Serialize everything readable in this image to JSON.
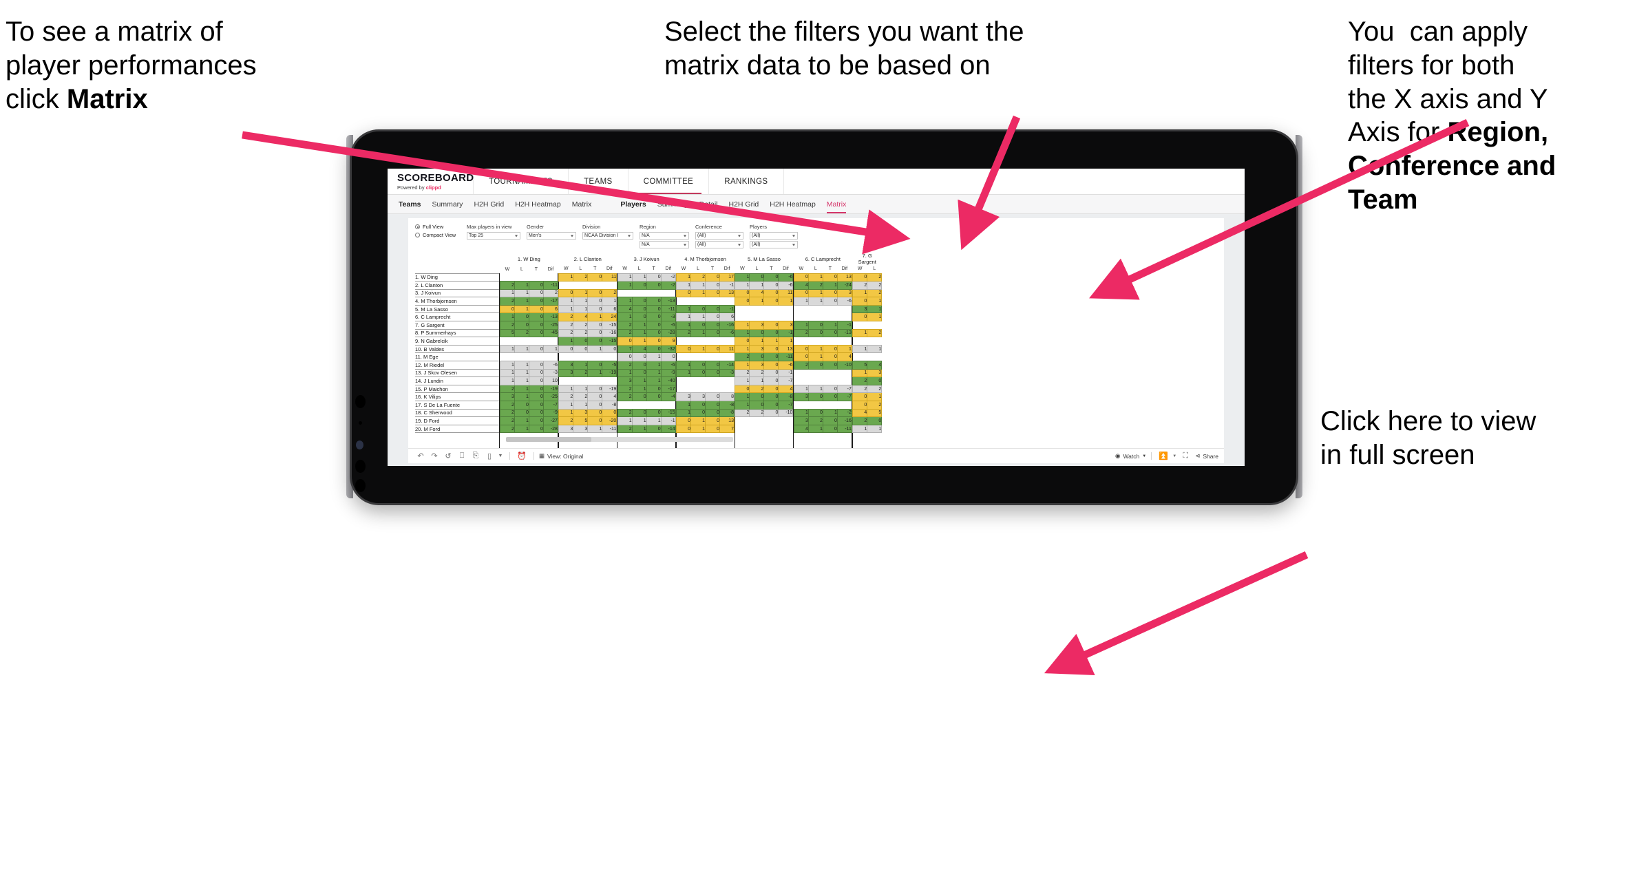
{
  "annotations": {
    "left": {
      "pre": "To see a matrix of\nplayer performances\nclick ",
      "bold": "Matrix"
    },
    "center": {
      "text": "Select the filters you want the\nmatrix data to be based on"
    },
    "right": {
      "pre": "You  can apply\nfilters for both\nthe X axis and Y\nAxis for ",
      "bold": "Region,\nConference and\nTeam"
    },
    "fullscreen": {
      "text": "Click here to view\nin full screen"
    }
  },
  "colors": {
    "accent_pink": "#ec2a64",
    "brand_pink": "#e8275e",
    "tab_active": "#d5366a",
    "cell_green": "#6aa84f",
    "cell_yellow": "#f2c744",
    "cell_grey": "#d9d9d9"
  },
  "app": {
    "brand": {
      "title": "SCOREBOARD",
      "powered_prefix": "Powered by ",
      "powered_name": "clippd"
    },
    "topnav": [
      {
        "label": "TOURNAMENTS",
        "active": false
      },
      {
        "label": "TEAMS",
        "active": false
      },
      {
        "label": "COMMITTEE",
        "active": true
      },
      {
        "label": "RANKINGS",
        "active": false
      }
    ],
    "subnav": [
      {
        "head": "Teams",
        "items": [
          {
            "label": "Summary",
            "active": false
          },
          {
            "label": "H2H Grid",
            "active": false
          },
          {
            "label": "H2H Heatmap",
            "active": false
          },
          {
            "label": "Matrix",
            "active": false
          }
        ]
      },
      {
        "head": "Players",
        "items": [
          {
            "label": "Summary",
            "active": false
          },
          {
            "label": "Detail",
            "active": false
          },
          {
            "label": "H2H Grid",
            "active": false
          },
          {
            "label": "H2H Heatmap",
            "active": false
          },
          {
            "label": "Matrix",
            "active": true
          }
        ]
      }
    ]
  },
  "filters": {
    "view_mode": {
      "full_label": "Full View",
      "compact_label": "Compact View",
      "selected": "Full View"
    },
    "fields": [
      {
        "label": "Max players in view",
        "values": [
          "Top 25"
        ]
      },
      {
        "label": "Gender",
        "values": [
          "Men's"
        ]
      },
      {
        "label": "Division",
        "values": [
          "NCAA Division I"
        ]
      },
      {
        "label": "Region",
        "values": [
          "N/A",
          "N/A"
        ]
      },
      {
        "label": "Conference",
        "values": [
          "(All)",
          "(All)"
        ]
      },
      {
        "label": "Players",
        "values": [
          "(All)",
          "(All)"
        ]
      }
    ]
  },
  "matrix": {
    "sub_headers": [
      "W",
      "L",
      "T",
      "Dif"
    ],
    "columns": [
      {
        "label": "1. W Ding",
        "fields": 4
      },
      {
        "label": "2. L Clanton",
        "fields": 4
      },
      {
        "label": "3. J Koivun",
        "fields": 4
      },
      {
        "label": "4. M Thorbjornsen",
        "fields": 4
      },
      {
        "label": "5. M La Sasso",
        "fields": 4
      },
      {
        "label": "6. C Lamprecht",
        "fields": 4
      },
      {
        "label": "7. G Sargent",
        "fields": 2
      }
    ],
    "rows": [
      {
        "name": "1. W Ding",
        "cells": [
          [
            null,
            null,
            null,
            null
          ],
          [
            "1",
            "2",
            "0",
            "11",
            "y"
          ],
          [
            "1",
            "1",
            "0",
            "-2",
            "n"
          ],
          [
            "1",
            "2",
            "0",
            "17",
            "y"
          ],
          [
            "1",
            "0",
            "0",
            "-6",
            "g"
          ],
          [
            "0",
            "1",
            "0",
            "13",
            "y"
          ],
          [
            "0",
            "2",
            "y"
          ]
        ]
      },
      {
        "name": "2. L Clanton",
        "cells": [
          [
            "2",
            "1",
            "0",
            "-11",
            "g"
          ],
          [
            null,
            null,
            null,
            null
          ],
          [
            "1",
            "0",
            "0",
            "-2",
            "g"
          ],
          [
            "1",
            "1",
            "0",
            "-1",
            "n"
          ],
          [
            "1",
            "1",
            "0",
            "-6",
            "n"
          ],
          [
            "4",
            "2",
            "1",
            "-24",
            "g"
          ],
          [
            "2",
            "2",
            "n"
          ]
        ]
      },
      {
        "name": "3. J Koivun",
        "cells": [
          [
            "1",
            "1",
            "0",
            "2",
            "n"
          ],
          [
            "0",
            "1",
            "0",
            "2",
            "y"
          ],
          [
            null,
            null,
            null,
            null
          ],
          [
            "0",
            "1",
            "0",
            "13",
            "y"
          ],
          [
            "0",
            "4",
            "0",
            "11",
            "y"
          ],
          [
            "0",
            "1",
            "0",
            "3",
            "y"
          ],
          [
            "1",
            "2",
            "y"
          ]
        ]
      },
      {
        "name": "4. M Thorbjornsen",
        "cells": [
          [
            "2",
            "1",
            "0",
            "-17",
            "g"
          ],
          [
            "1",
            "1",
            "0",
            "1",
            "n"
          ],
          [
            "1",
            "0",
            "0",
            "-13",
            "g"
          ],
          [
            null,
            null,
            null,
            null
          ],
          [
            "0",
            "1",
            "0",
            "1",
            "y"
          ],
          [
            "1",
            "1",
            "0",
            "-6",
            "n"
          ],
          [
            "0",
            "1",
            "y"
          ]
        ]
      },
      {
        "name": "5. M La Sasso",
        "cells": [
          [
            "0",
            "1",
            "0",
            "6",
            "y"
          ],
          [
            "1",
            "1",
            "0",
            "6",
            "n"
          ],
          [
            "4",
            "0",
            "0",
            "-11",
            "g"
          ],
          [
            "1",
            "0",
            "0",
            "-1",
            "g"
          ],
          [
            null,
            null,
            null,
            null
          ],
          [
            null,
            null,
            null,
            null
          ],
          [
            "3",
            "1",
            "g"
          ]
        ]
      },
      {
        "name": "6. C Lamprecht",
        "cells": [
          [
            "1",
            "0",
            "0",
            "-13",
            "g"
          ],
          [
            "2",
            "4",
            "1",
            "24",
            "y"
          ],
          [
            "1",
            "0",
            "0",
            "-3",
            "g"
          ],
          [
            "1",
            "1",
            "0",
            "6",
            "n"
          ],
          [
            null,
            null,
            null,
            null
          ],
          [
            null,
            null,
            null,
            null
          ],
          [
            "0",
            "1",
            "y"
          ]
        ]
      },
      {
        "name": "7. G Sargent",
        "cells": [
          [
            "2",
            "0",
            "0",
            "-25",
            "g"
          ],
          [
            "2",
            "2",
            "0",
            "-15",
            "n"
          ],
          [
            "2",
            "1",
            "0",
            "-6",
            "g"
          ],
          [
            "1",
            "0",
            "0",
            "-16",
            "g"
          ],
          [
            "1",
            "3",
            "0",
            "3",
            "y"
          ],
          [
            "1",
            "0",
            "1",
            "-1",
            "g"
          ],
          [
            null,
            null
          ]
        ]
      },
      {
        "name": "8. P Summerhays",
        "cells": [
          [
            "5",
            "2",
            "0",
            "-45",
            "g"
          ],
          [
            "2",
            "2",
            "0",
            "-16",
            "n"
          ],
          [
            "2",
            "1",
            "0",
            "-28",
            "g"
          ],
          [
            "2",
            "1",
            "0",
            "-6",
            "g"
          ],
          [
            "1",
            "0",
            "0",
            "-1",
            "g"
          ],
          [
            "2",
            "0",
            "0",
            "-13",
            "g"
          ],
          [
            "1",
            "2",
            "y"
          ]
        ]
      },
      {
        "name": "9. N Gabrelcik",
        "cells": [
          [
            null,
            null,
            null,
            null
          ],
          [
            "1",
            "0",
            "0",
            "-15",
            "g"
          ],
          [
            "0",
            "1",
            "0",
            "9",
            "y"
          ],
          [
            null,
            null,
            null,
            null
          ],
          [
            "0",
            "1",
            "1",
            "1",
            "y"
          ],
          [
            null,
            null,
            null,
            null
          ],
          [
            null,
            null
          ]
        ]
      },
      {
        "name": "10. B Valdes",
        "cells": [
          [
            "1",
            "1",
            "0",
            "1",
            "n"
          ],
          [
            "0",
            "0",
            "1",
            "0",
            "n"
          ],
          [
            "7",
            "4",
            "0",
            "-32",
            "g"
          ],
          [
            "0",
            "1",
            "0",
            "11",
            "y"
          ],
          [
            "1",
            "3",
            "0",
            "13",
            "y"
          ],
          [
            "0",
            "1",
            "0",
            "1",
            "y"
          ],
          [
            "1",
            "1",
            "n"
          ]
        ]
      },
      {
        "name": "11. M Ege",
        "cells": [
          [
            null,
            null,
            null,
            null
          ],
          [
            null,
            null,
            null,
            null
          ],
          [
            "0",
            "0",
            "1",
            "0",
            "n"
          ],
          [
            null,
            null,
            null,
            null
          ],
          [
            "2",
            "0",
            "0",
            "-11",
            "g"
          ],
          [
            "0",
            "1",
            "0",
            "4",
            "y"
          ],
          [
            null,
            null
          ]
        ]
      },
      {
        "name": "12. M Riedel",
        "cells": [
          [
            "1",
            "1",
            "0",
            "-6",
            "n"
          ],
          [
            "3",
            "1",
            "0",
            "-5",
            "g"
          ],
          [
            "2",
            "0",
            "1",
            "-6",
            "g"
          ],
          [
            "1",
            "0",
            "0",
            "-14",
            "g"
          ],
          [
            "1",
            "3",
            "0",
            "-6",
            "y"
          ],
          [
            "2",
            "0",
            "0",
            "-10",
            "g"
          ],
          [
            "5",
            "4",
            "g"
          ]
        ]
      },
      {
        "name": "13. J Skov Olesen",
        "cells": [
          [
            "1",
            "1",
            "0",
            "-3",
            "n"
          ],
          [
            "3",
            "2",
            "1",
            "-19",
            "g"
          ],
          [
            "1",
            "0",
            "1",
            "-9",
            "g"
          ],
          [
            "1",
            "0",
            "0",
            "-3",
            "g"
          ],
          [
            "2",
            "2",
            "0",
            "-1",
            "n"
          ],
          [
            null,
            null,
            null,
            null
          ],
          [
            "1",
            "3",
            "y"
          ]
        ]
      },
      {
        "name": "14. J Lundin",
        "cells": [
          [
            "1",
            "1",
            "0",
            "10",
            "n"
          ],
          [
            null,
            null,
            null,
            null
          ],
          [
            "3",
            "1",
            "1",
            "-40",
            "g"
          ],
          [
            null,
            null,
            null,
            null
          ],
          [
            "1",
            "1",
            "0",
            "-7",
            "n"
          ],
          [
            null,
            null,
            null,
            null
          ],
          [
            "2",
            "0",
            "g"
          ]
        ]
      },
      {
        "name": "15. P Maichon",
        "cells": [
          [
            "2",
            "1",
            "0",
            "-19",
            "g"
          ],
          [
            "1",
            "1",
            "0",
            "-19",
            "n"
          ],
          [
            "2",
            "1",
            "0",
            "-17",
            "g"
          ],
          [
            null,
            null,
            null,
            null
          ],
          [
            "0",
            "2",
            "0",
            "4",
            "y"
          ],
          [
            "1",
            "1",
            "0",
            "-7",
            "n"
          ],
          [
            "2",
            "2",
            "n"
          ]
        ]
      },
      {
        "name": "16. K Vilips",
        "cells": [
          [
            "3",
            "1",
            "0",
            "-25",
            "g"
          ],
          [
            "2",
            "2",
            "0",
            "4",
            "n"
          ],
          [
            "2",
            "0",
            "0",
            "-4",
            "g"
          ],
          [
            "3",
            "3",
            "0",
            "8",
            "n"
          ],
          [
            "1",
            "0",
            "0",
            "-8",
            "g"
          ],
          [
            "3",
            "0",
            "0",
            "-7",
            "g"
          ],
          [
            "0",
            "1",
            "y"
          ]
        ]
      },
      {
        "name": "17. S De La Fuente",
        "cells": [
          [
            "2",
            "0",
            "0",
            "-7",
            "g"
          ],
          [
            "1",
            "1",
            "0",
            "-8",
            "n"
          ],
          [
            null,
            null,
            null,
            null
          ],
          [
            "1",
            "0",
            "0",
            "-8",
            "g"
          ],
          [
            "1",
            "0",
            "0",
            "-7",
            "g"
          ],
          [
            null,
            null,
            null,
            null
          ],
          [
            "0",
            "2",
            "y"
          ]
        ]
      },
      {
        "name": "18. C Sherwood",
        "cells": [
          [
            "2",
            "0",
            "0",
            "-9",
            "g"
          ],
          [
            "1",
            "3",
            "0",
            "0",
            "y"
          ],
          [
            "2",
            "0",
            "0",
            "-15",
            "g"
          ],
          [
            "1",
            "0",
            "0",
            "-8",
            "g"
          ],
          [
            "2",
            "2",
            "0",
            "-10",
            "n"
          ],
          [
            "1",
            "0",
            "1",
            "-2",
            "g"
          ],
          [
            "4",
            "5",
            "y"
          ]
        ]
      },
      {
        "name": "19. D Ford",
        "cells": [
          [
            "2",
            "1",
            "0",
            "-27",
            "g"
          ],
          [
            "2",
            "5",
            "0",
            "-20",
            "y"
          ],
          [
            "1",
            "1",
            "1",
            "-1",
            "n"
          ],
          [
            "0",
            "1",
            "0",
            "13",
            "y"
          ],
          [
            null,
            null,
            null,
            null
          ],
          [
            "3",
            "2",
            "0",
            "-16",
            "g"
          ],
          [
            "2",
            "0",
            "g"
          ]
        ]
      },
      {
        "name": "20. M Ford",
        "cells": [
          [
            "2",
            "1",
            "0",
            "-28",
            "g"
          ],
          [
            "3",
            "3",
            "1",
            "-11",
            "n"
          ],
          [
            "2",
            "1",
            "0",
            "-14",
            "g"
          ],
          [
            "0",
            "1",
            "0",
            "7",
            "y"
          ],
          [
            null,
            null,
            null,
            null
          ],
          [
            "4",
            "1",
            "0",
            "-11",
            "g"
          ],
          [
            "1",
            "1",
            "n"
          ]
        ]
      }
    ]
  },
  "toolbar": {
    "view_label": "View: Original",
    "watch_label": "Watch",
    "share_label": "Share"
  }
}
